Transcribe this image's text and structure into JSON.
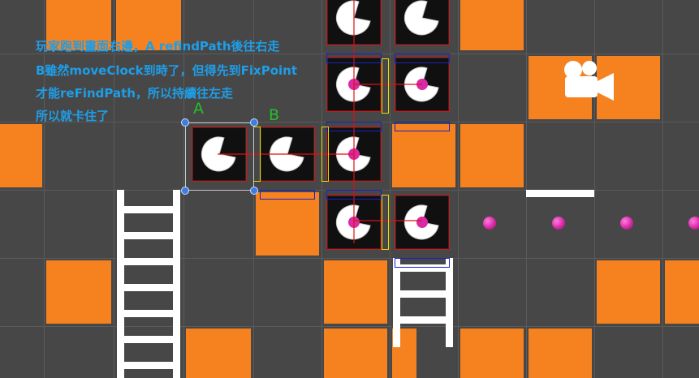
{
  "notes": [
    "玩家跑到畫面右邊，A refindPath後往右走",
    "B雖然moveClock到時了，但得先到FixPoint",
    "才能reFindPath，所以持續往左走",
    "所以就卡住了"
  ],
  "labels": {
    "a": "A",
    "b": "B"
  },
  "icons": {
    "camera": "camera-icon",
    "pacman": "pacman-sprite",
    "pellet": "pellet"
  },
  "colors": {
    "background": "#474747",
    "tile": "#f5821f",
    "path_line": "#dd1111",
    "collider_blue": "#1a22c8",
    "collider_yellow": "#e8e000",
    "annotation_text": "#1e9ee8",
    "label_text": "#22c028"
  }
}
